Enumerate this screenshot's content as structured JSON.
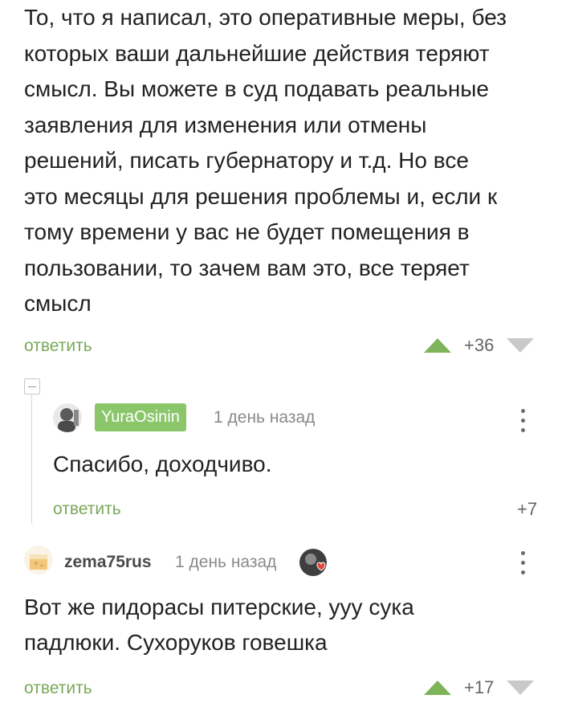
{
  "comment1": {
    "lines": [
      "То, что я написал, это оперативные меры, без",
      "которых ваши дальнейшие действия теряют",
      "смысл. Вы можете в суд подавать реальные",
      "заявления для изменения или отмены",
      "решений, писать губернатору и т.д. Но все",
      "это месяцы для решения проблемы и, если к",
      "тому времени у вас не будет помещения в",
      "пользовании, то зачем вам это, все теряет",
      "смысл"
    ],
    "reply_label": "ответить",
    "score": "+36"
  },
  "comment2": {
    "username": "YuraOsinin",
    "timestamp": "1 день назад",
    "text": "Спасибо, доходчиво.",
    "reply_label": "ответить",
    "score": "+7"
  },
  "comment3": {
    "username": "zema75rus",
    "timestamp": "1 день назад",
    "lines": [
      "Вот же пидорасы питерские, ууу сука",
      "падлюки. Сухоруков говешка"
    ],
    "reply_label": "ответить",
    "score": "+17"
  },
  "colors": {
    "accent_green": "#7aa85a",
    "badge_green": "#8bc66b",
    "vote_up": "#7fb35a",
    "vote_down": "#c9c9c9"
  },
  "icons": [
    "vote-up-icon",
    "vote-down-icon",
    "more-options-icon",
    "collapse-icon",
    "heart-badge-icon"
  ]
}
